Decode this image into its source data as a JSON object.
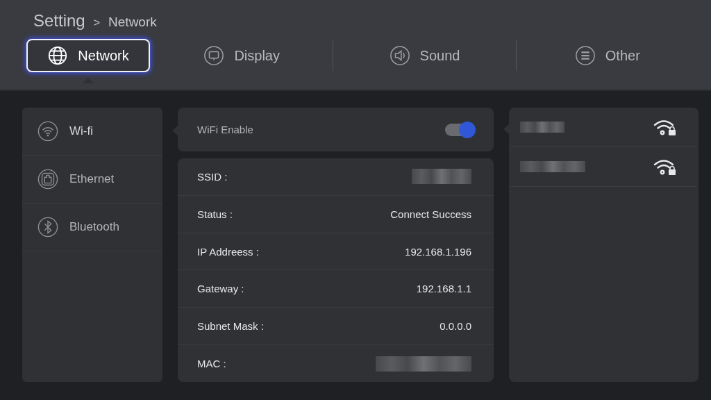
{
  "breadcrumb": {
    "root": "Setting",
    "separator": ">",
    "current": "Network"
  },
  "tabs": [
    {
      "label": "Network",
      "selected": true
    },
    {
      "label": "Display",
      "selected": false
    },
    {
      "label": "Sound",
      "selected": false
    },
    {
      "label": "Other",
      "selected": false
    }
  ],
  "sidebar": {
    "items": [
      {
        "label": "Wi-fi",
        "selected": true
      },
      {
        "label": "Ethernet",
        "selected": false
      },
      {
        "label": "Bluetooth",
        "selected": false
      }
    ]
  },
  "wifi_enable": {
    "label": "WiFi Enable",
    "on": true
  },
  "info": [
    {
      "label": "SSID :",
      "kind": "blurred"
    },
    {
      "label": "Status :",
      "kind": "text",
      "value": "Connect Success"
    },
    {
      "label": "IP Addreess :",
      "kind": "text",
      "value": "192.168.1.196"
    },
    {
      "label": "Gateway :",
      "kind": "text",
      "value": "192.168.1.1"
    },
    {
      "label": "Subnet Mask :",
      "kind": "text",
      "value": "0.0.0.0"
    },
    {
      "label": "MAC :",
      "kind": "blurred"
    }
  ],
  "networks": [
    {
      "kind": "blurred",
      "secured": true
    },
    {
      "kind": "blurred",
      "secured": true
    }
  ]
}
